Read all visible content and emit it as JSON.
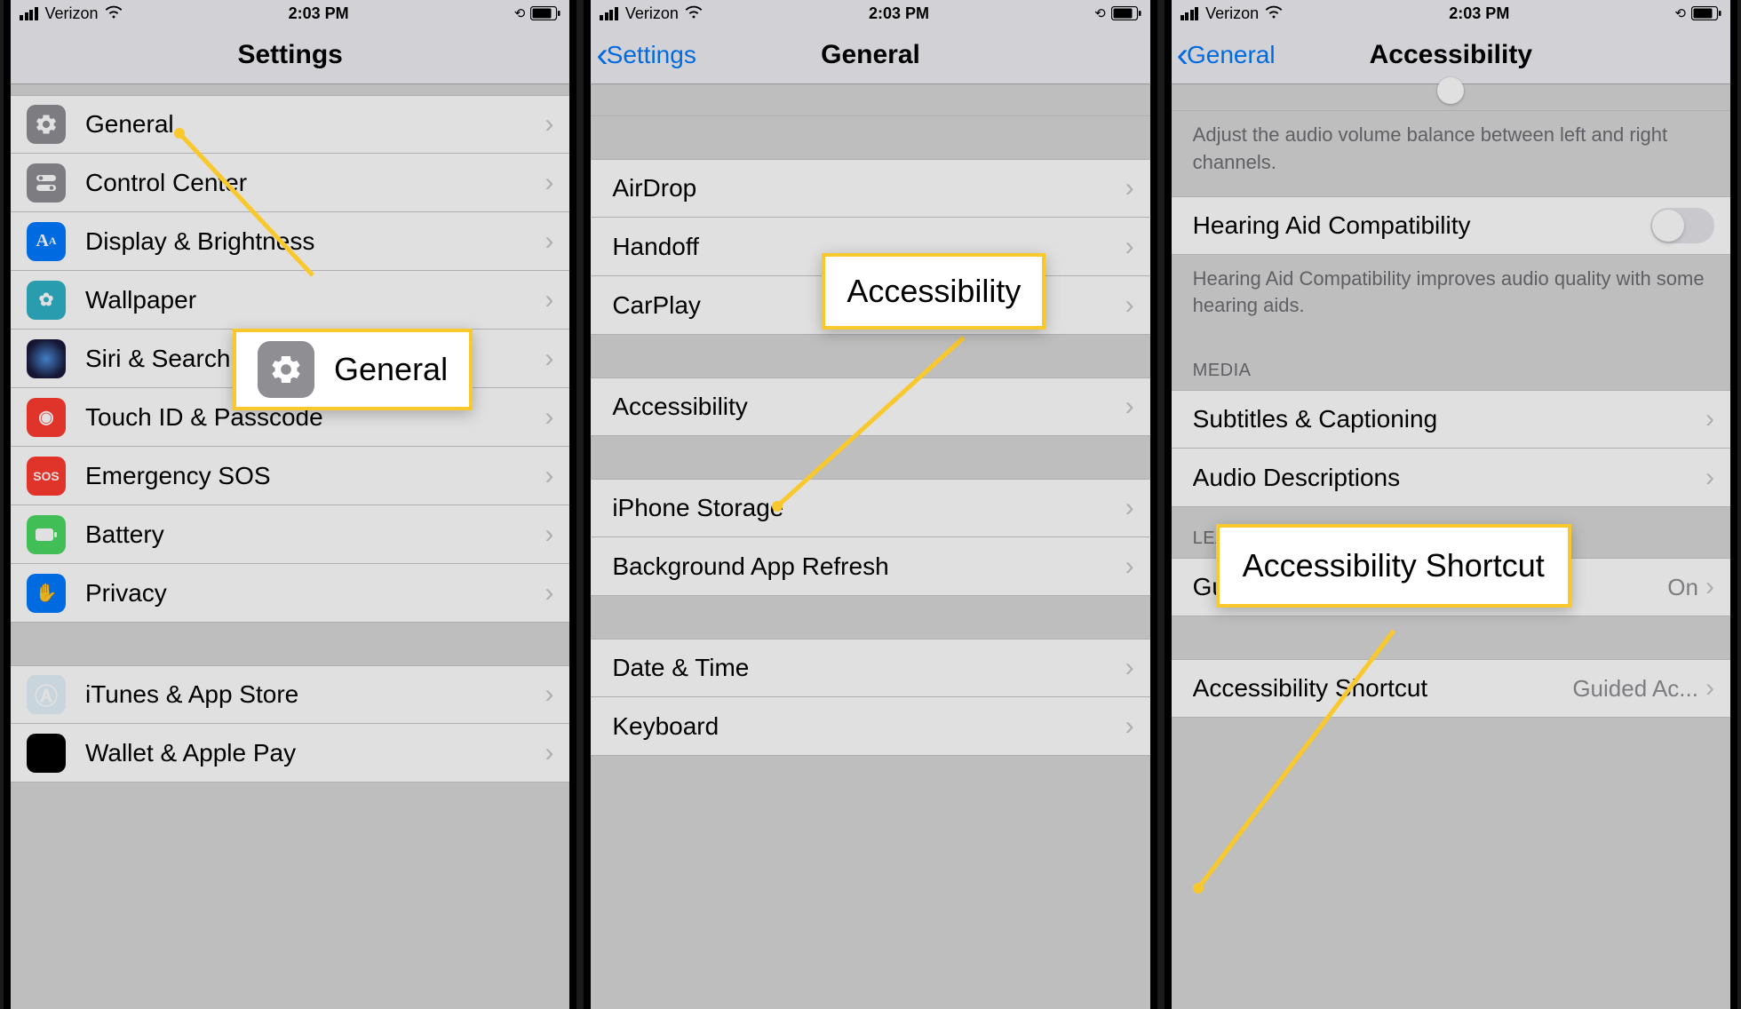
{
  "status": {
    "carrier": "Verizon",
    "time": "2:03 PM"
  },
  "screen1": {
    "title": "Settings",
    "callout_label": "General",
    "rows": [
      {
        "label": "General"
      },
      {
        "label": "Control Center"
      },
      {
        "label": "Display & Brightness"
      },
      {
        "label": "Wallpaper"
      },
      {
        "label": "Siri & Search"
      },
      {
        "label": "Touch ID & Passcode"
      },
      {
        "label": "Emergency SOS"
      },
      {
        "label": "Battery"
      },
      {
        "label": "Privacy"
      },
      {
        "label": "iTunes & App Store"
      },
      {
        "label": "Wallet & Apple Pay"
      }
    ]
  },
  "screen2": {
    "back": "Settings",
    "title": "General",
    "callout_label": "Accessibility",
    "groups": {
      "g1": [
        "AirDrop",
        "Handoff",
        "CarPlay"
      ],
      "g2": [
        "Accessibility"
      ],
      "g3": [
        "iPhone Storage",
        "Background App Refresh"
      ],
      "g4": [
        "Date & Time",
        "Keyboard"
      ]
    }
  },
  "screen3": {
    "back": "General",
    "title": "Accessibility",
    "callout_label": "Accessibility Shortcut",
    "footer1": "Adjust the audio volume balance between left and right channels.",
    "row_hearing": "Hearing Aid Compatibility",
    "footer2": "Hearing Aid Compatibility improves audio quality with some hearing aids.",
    "section_media": "MEDIA",
    "row_subtitles": "Subtitles & Captioning",
    "row_audio": "Audio Descriptions",
    "section_learning": "LEARNING",
    "row_guided": "Guided Access",
    "row_guided_val": "On",
    "row_shortcut": "Accessibility Shortcut",
    "row_shortcut_val": "Guided Ac..."
  }
}
